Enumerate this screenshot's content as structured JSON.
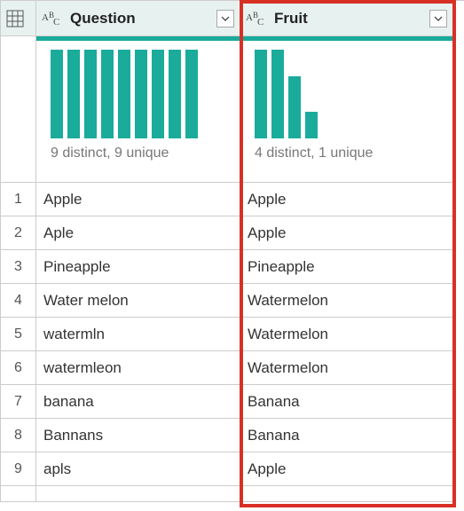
{
  "columns": [
    {
      "name": "Question",
      "type_icon": "abc",
      "profile": {
        "summary": "9 distinct, 9 unique",
        "bars": [
          100,
          100,
          100,
          100,
          100,
          100,
          100,
          100,
          100
        ]
      }
    },
    {
      "name": "Fruit",
      "type_icon": "abc",
      "profile": {
        "summary": "4 distinct, 1 unique",
        "bars": [
          100,
          100,
          70,
          30
        ]
      }
    }
  ],
  "rows": [
    {
      "n": "1",
      "Question": "Apple",
      "Fruit": "Apple"
    },
    {
      "n": "2",
      "Question": "Aple",
      "Fruit": "Apple"
    },
    {
      "n": "3",
      "Question": "Pineapple",
      "Fruit": "Pineapple"
    },
    {
      "n": "4",
      "Question": "Water melon",
      "Fruit": "Watermelon"
    },
    {
      "n": "5",
      "Question": "watermln",
      "Fruit": "Watermelon"
    },
    {
      "n": "6",
      "Question": "watermleon",
      "Fruit": "Watermelon"
    },
    {
      "n": "7",
      "Question": "banana",
      "Fruit": "Banana"
    },
    {
      "n": "8",
      "Question": "Bannans",
      "Fruit": "Banana"
    },
    {
      "n": "9",
      "Question": "apls",
      "Fruit": "Apple"
    }
  ],
  "colors": {
    "accent": "#1aab9b",
    "highlight": "#d93025"
  }
}
